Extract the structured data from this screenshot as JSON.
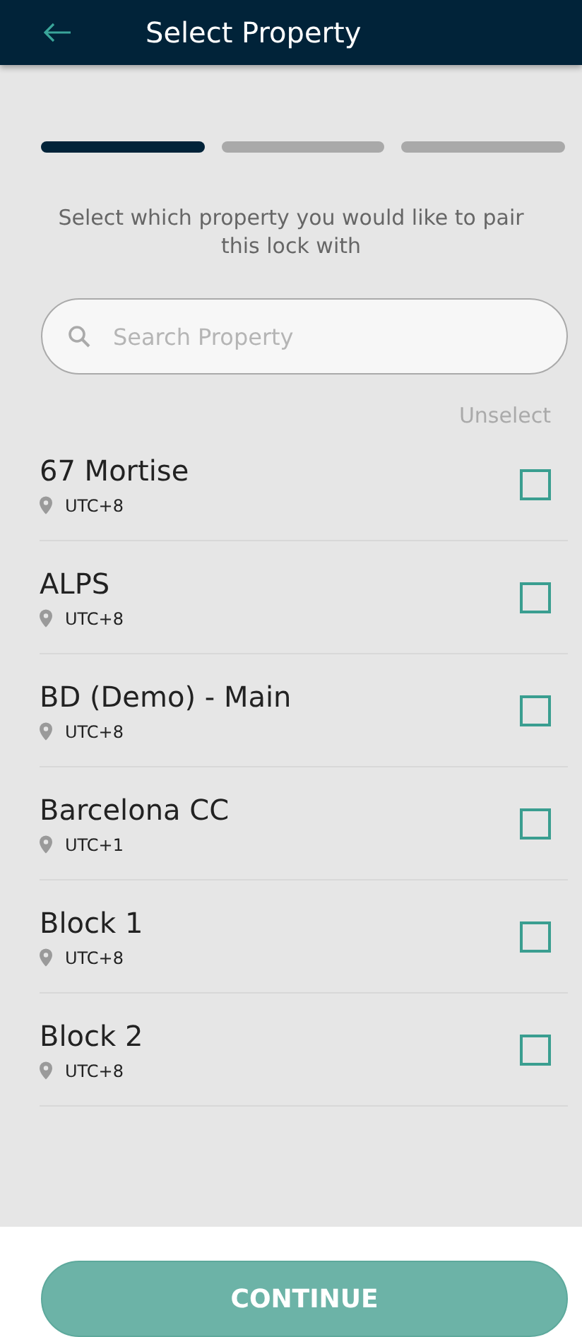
{
  "header": {
    "title": "Select Property"
  },
  "progress": [
    {
      "active": true
    },
    {
      "active": false
    },
    {
      "active": false
    }
  ],
  "instruction": "Select which property you would like to pair this lock with",
  "search": {
    "placeholder": "Search Property"
  },
  "unselect_link": "Unselect",
  "properties": [
    {
      "name": "67 Mortise",
      "timezone": "UTC+8",
      "checked": false
    },
    {
      "name": "ALPS",
      "timezone": "UTC+8",
      "checked": false
    },
    {
      "name": "BD (Demo) - Main",
      "timezone": "UTC+8",
      "checked": false
    },
    {
      "name": "Barcelona CC",
      "timezone": "UTC+1",
      "checked": false
    },
    {
      "name": "Block 1",
      "timezone": "UTC+8",
      "checked": false
    },
    {
      "name": "Block 2",
      "timezone": "UTC+8",
      "checked": false
    }
  ],
  "continue_button": {
    "label": "CONTINUE",
    "disabled": true
  }
}
